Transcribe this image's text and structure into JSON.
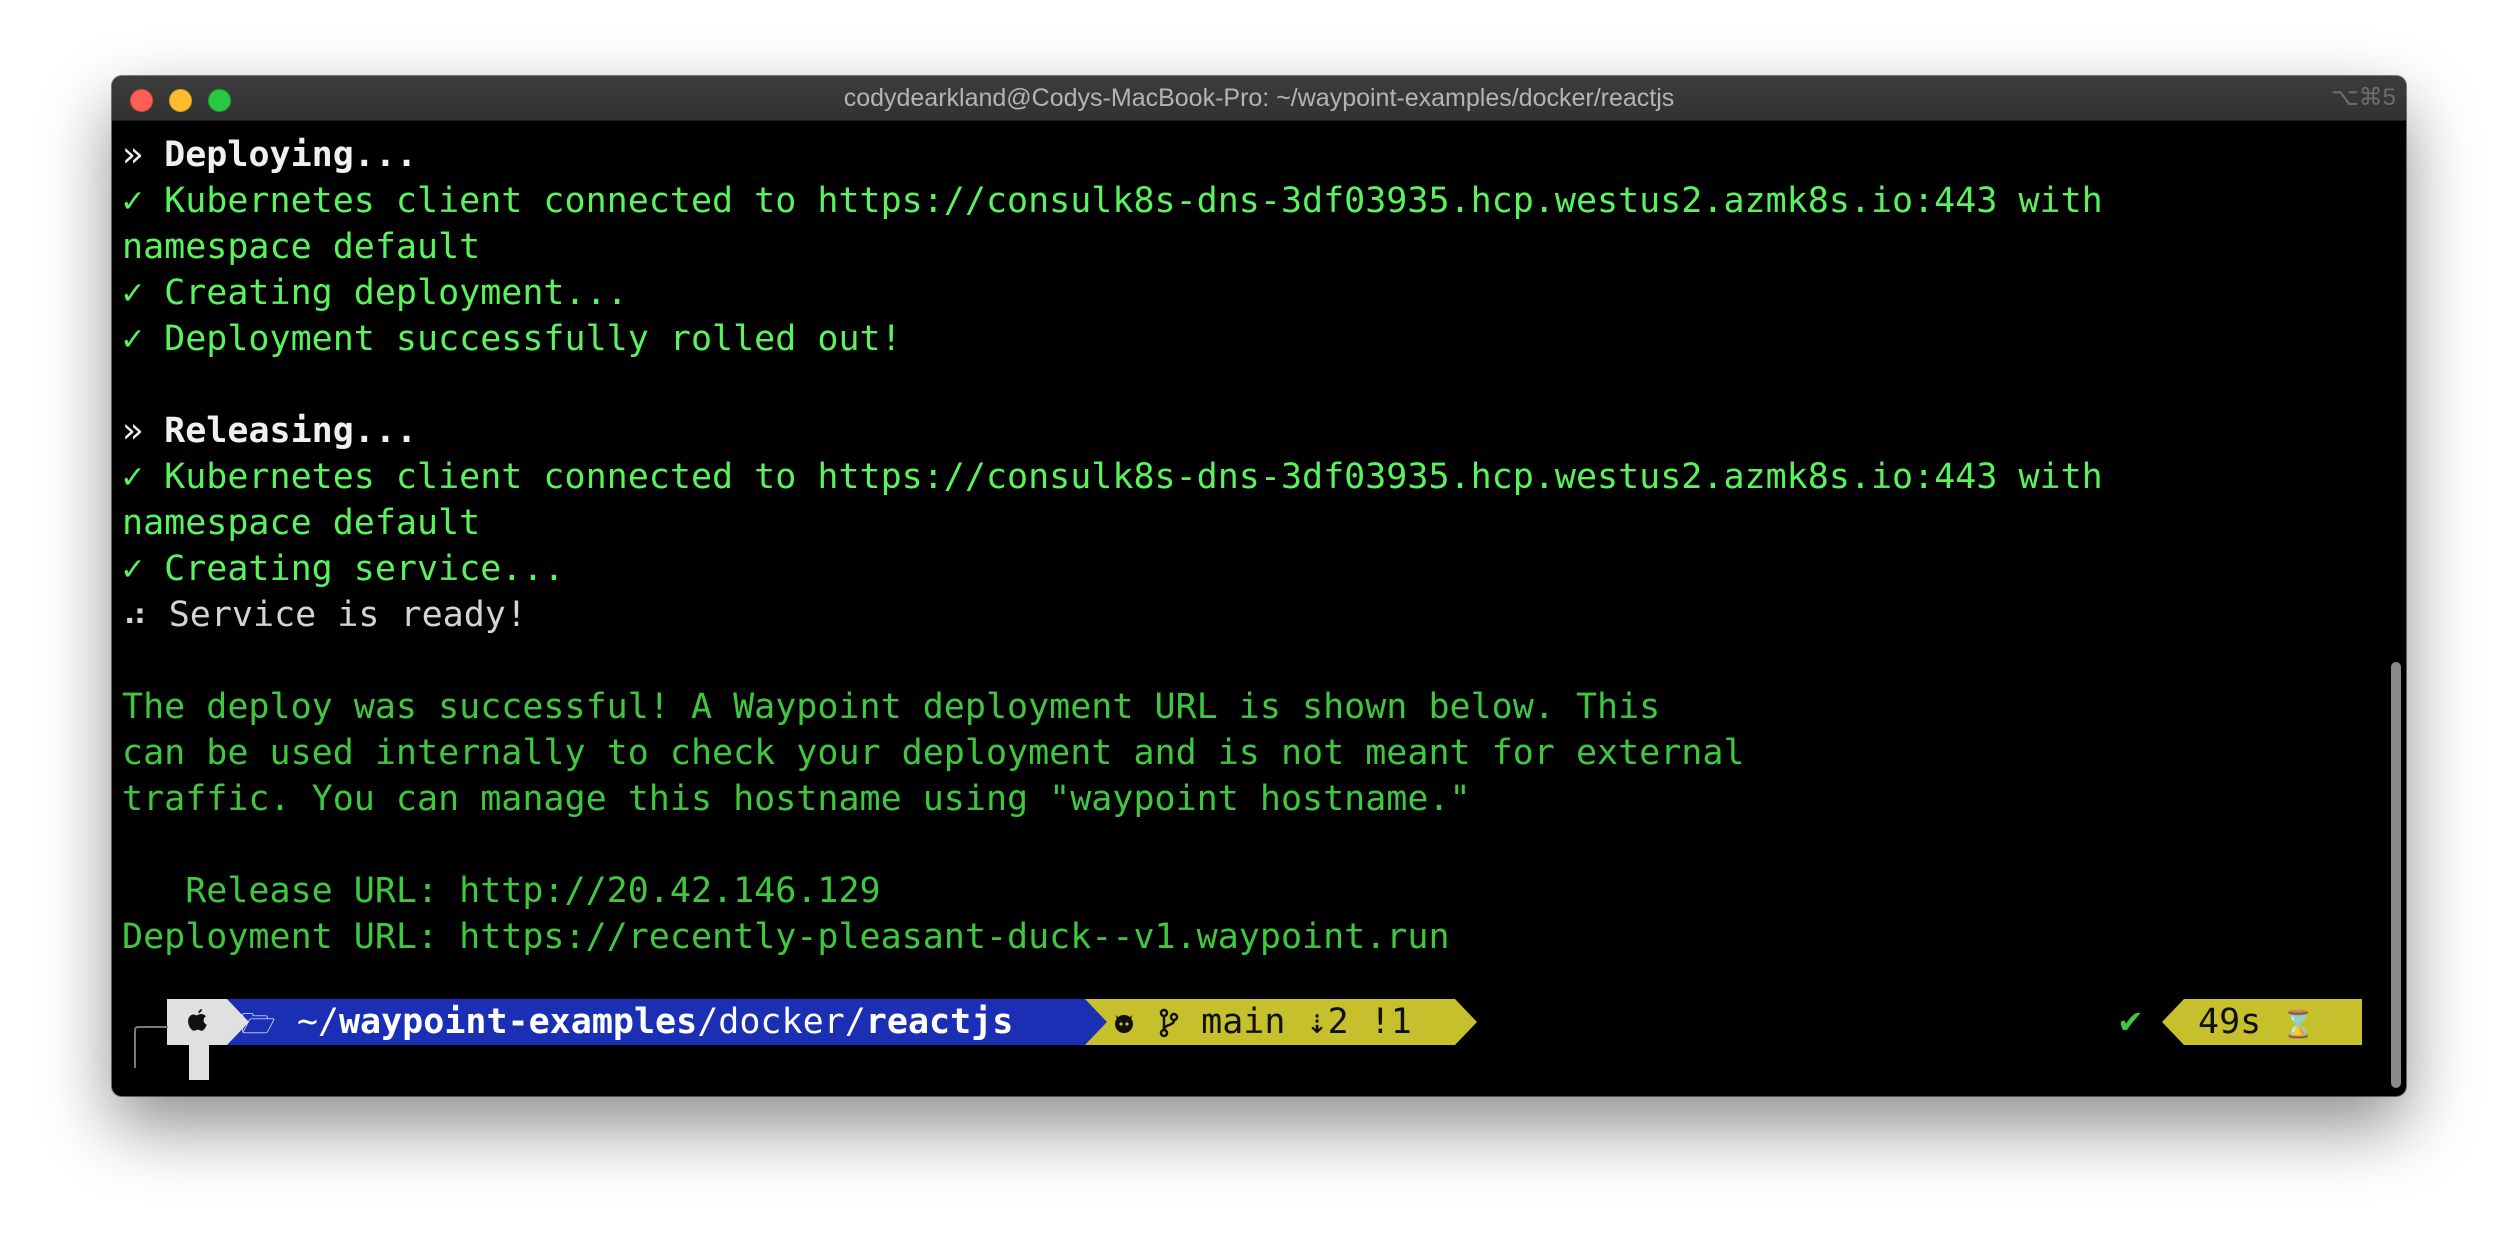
{
  "window": {
    "title": "codydearkland@Codys-MacBook-Pro: ~/waypoint-examples/docker/reactjs",
    "shortcut": "⌥⌘5"
  },
  "terminal": {
    "lines": [
      {
        "prefix": "» ",
        "text": "Deploying..."
      },
      {
        "text": "✓ Kubernetes client connected to https://consulk8s-dns-3df03935.hcp.westus2.azmk8s.io:443 with"
      },
      {
        "text": "namespace default"
      },
      {
        "text": "✓ Creating deployment..."
      },
      {
        "text": "✓ Deployment successfully rolled out!"
      },
      {
        "prefix": "» ",
        "text": "Releasing..."
      },
      {
        "text": "✓ Kubernetes client connected to https://consulk8s-dns-3df03935.hcp.westus2.azmk8s.io:443 with"
      },
      {
        "text": "namespace default"
      },
      {
        "text": "✓ Creating service..."
      },
      {
        "prefix": "⠴ ",
        "text": "Service is ready!"
      },
      {
        "text": "The deploy was successful! A Waypoint deployment URL is shown below. This"
      },
      {
        "text": "can be used internally to check your deployment and is not meant for external"
      },
      {
        "text": "traffic. You can manage this hostname using \"waypoint hostname.\""
      },
      {
        "text": "   Release URL: http://20.42.146.129"
      },
      {
        "text": "Deployment URL: https://recently-pleasant-duck--v1.waypoint.run"
      }
    ]
  },
  "prompt": {
    "os_icon": "apple-icon",
    "folder_icon": "folder-icon",
    "path_home": "~/",
    "path_repo": "waypoint-examples",
    "path_sep1": "/",
    "path_mid": "docker",
    "path_sep2": "/",
    "path_dir": "reactjs",
    "git_icon": "github-icon",
    "branch_icon": "git-branch-icon",
    "git_status": "main ⇣2 !1",
    "status_icon": "checkmark-icon",
    "status_check": "✔",
    "duration": "49s",
    "duration_icon": "hourglass-icon",
    "hourglass": "⌛"
  },
  "colors": {
    "terminal_bg": "#000000",
    "success_green": "#5af35e",
    "message_green": "#3fc83f",
    "path_blue": "#1b2fb5",
    "git_yellow": "#c5c02c"
  }
}
